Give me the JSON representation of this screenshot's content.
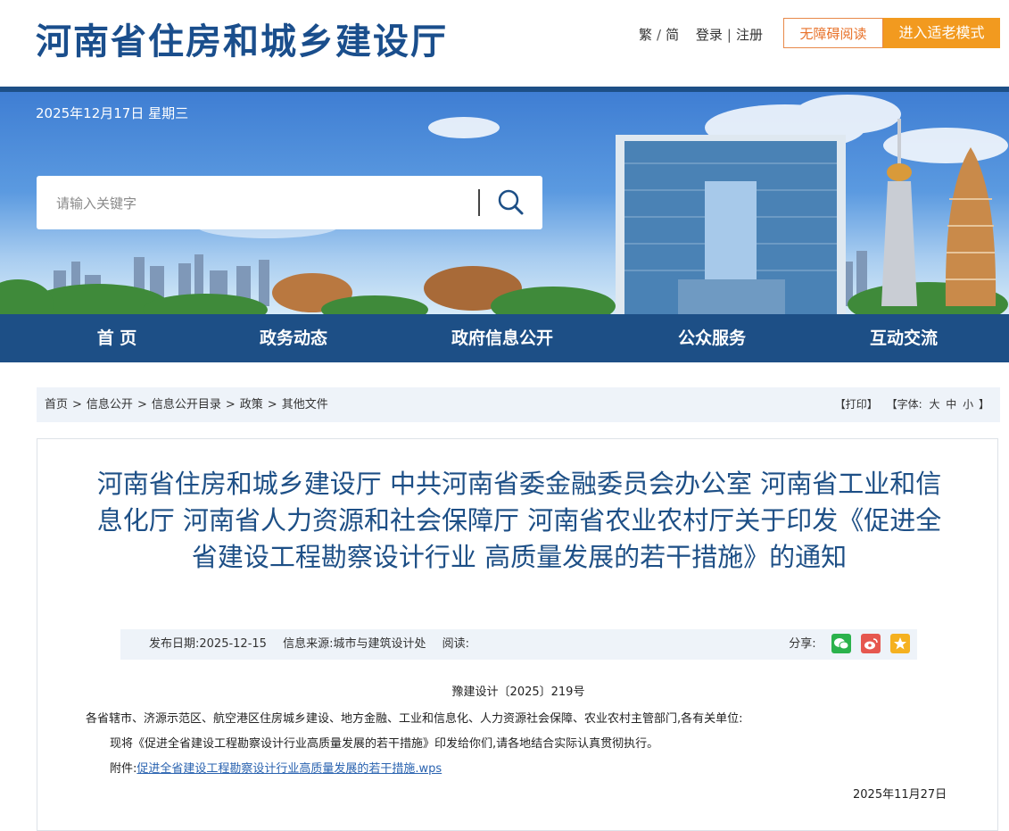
{
  "header": {
    "site_title": "河南省住房和城乡建设厅",
    "traditional": "繁",
    "slash": "/",
    "simplified": "简",
    "login": "登录",
    "bar": "|",
    "register": "注册",
    "accessible_btn": "无障碍阅读",
    "elder_btn": "进入适老模式"
  },
  "banner": {
    "date": "2025年12月17日 星期三",
    "search_placeholder": "请输入关键字"
  },
  "nav": {
    "items": [
      "首 页",
      "政务动态",
      "政府信息公开",
      "公众服务",
      "互动交流"
    ]
  },
  "breadcrumb": {
    "items": [
      "首页",
      "信息公开",
      "信息公开目录",
      "政策",
      "其他文件"
    ],
    "arrow": ">",
    "print": "【打印】",
    "font_label": "【字体:",
    "font_large": "大",
    "font_medium": "中",
    "font_small": "小",
    "font_end": "】"
  },
  "article": {
    "title": "河南省住房和城乡建设厅 中共河南省委金融委员会办公室 河南省工业和信息化厅 河南省人力资源和社会保障厅 河南省农业农村厅关于印发《促进全省建设工程勘察设计行业 高质量发展的若干措施》的通知",
    "publish_date": "发布日期:2025-12-15",
    "source": "信息来源:城市与建筑设计处",
    "reads": "阅读:",
    "share_label": "分享:",
    "doc_number": "豫建设计〔2025〕219号",
    "recipients": "各省辖市、济源示范区、航空港区住房城乡建设、地方金融、工业和信息化、人力资源社会保障、农业农村主管部门,各有关单位:",
    "body": "现将《促进全省建设工程勘察设计行业高质量发展的若干措施》印发给你们,请各地结合实际认真贯彻执行。",
    "attach_label": "附件:",
    "attach_link": "促进全省建设工程勘察设计行业高质量发展的若干措施.wps",
    "sign_date": "2025年11月27日"
  },
  "colors": {
    "primary": "#1d4f86",
    "orange": "#f29a1f",
    "wechat": "#2bb24c",
    "weibo": "#e6574f",
    "favorite": "#f5b120"
  }
}
